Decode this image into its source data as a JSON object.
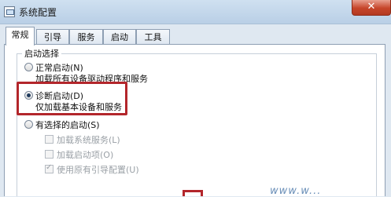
{
  "window": {
    "title": "系统配置",
    "close_label": "✕"
  },
  "tabs": [
    {
      "label": "常规",
      "active": true
    },
    {
      "label": "引导",
      "active": false
    },
    {
      "label": "服务",
      "active": false
    },
    {
      "label": "启动",
      "active": false
    },
    {
      "label": "工具",
      "active": false
    }
  ],
  "startup": {
    "group_title": "启动选择",
    "options": [
      {
        "label": "正常启动(N)",
        "desc": "加载所有设备驱动程序和服务",
        "selected": false
      },
      {
        "label": "诊断启动(D)",
        "desc": "仅加载基本设备和服务",
        "selected": true
      },
      {
        "label": "有选择的启动(S)",
        "selected": false
      }
    ],
    "selective": [
      {
        "label": "加载系统服务(L)",
        "checked": false
      },
      {
        "label": "加载启动项(O)",
        "checked": false
      },
      {
        "label": "使用原有引导配置(U)",
        "checked": true
      }
    ]
  },
  "watermark": "www.w..."
}
